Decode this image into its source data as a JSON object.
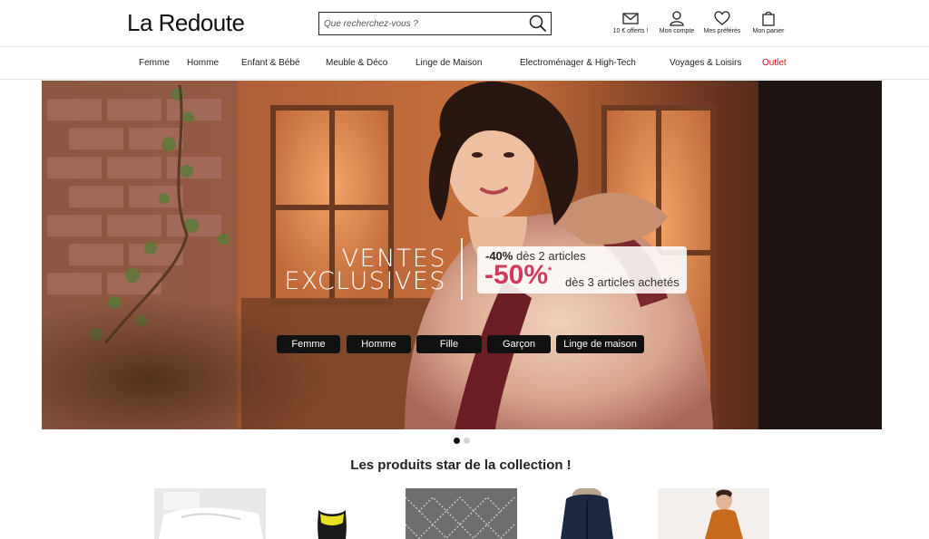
{
  "header": {
    "logo": "La Redoute",
    "search_placeholder": "Que recherchez-vous ?",
    "actions": [
      {
        "label": "10 € offerts !",
        "icon": "envelope-icon"
      },
      {
        "label": "Mon compte",
        "icon": "user-icon"
      },
      {
        "label": "Mes préférés",
        "icon": "heart-icon"
      },
      {
        "label": "Mon panier",
        "icon": "shopping-bag-icon"
      }
    ]
  },
  "nav": {
    "items": [
      {
        "label": "Femme"
      },
      {
        "label": "Homme"
      },
      {
        "label": "Enfant & Bébé"
      },
      {
        "label": "Meuble & Déco"
      },
      {
        "label": "Linge de Maison"
      },
      {
        "label": "Electroménager & High-Tech"
      },
      {
        "label": "Voyages & Loisirs"
      },
      {
        "label": "Outlet",
        "color": "#d0121b"
      }
    ]
  },
  "hero": {
    "title_line1": "VENTES",
    "title_line2": "EXCLUSIVES",
    "offer1_pct": "-40%",
    "offer1_text": "dès 2 articles",
    "offer2_pct": "-50%",
    "offer2_mark": "*",
    "offer2_text": "dès 3 articles achetés",
    "buttons": [
      "Femme",
      "Homme",
      "Fille",
      "Garçon",
      "Linge de maison"
    ],
    "slides_total": 2,
    "slide_active": 1
  },
  "products": {
    "title": "Les produits star de la collection !"
  },
  "colors": {
    "accent_red": "#d0121b",
    "promo_pink": "#d23a5b",
    "button_black": "#111111"
  }
}
